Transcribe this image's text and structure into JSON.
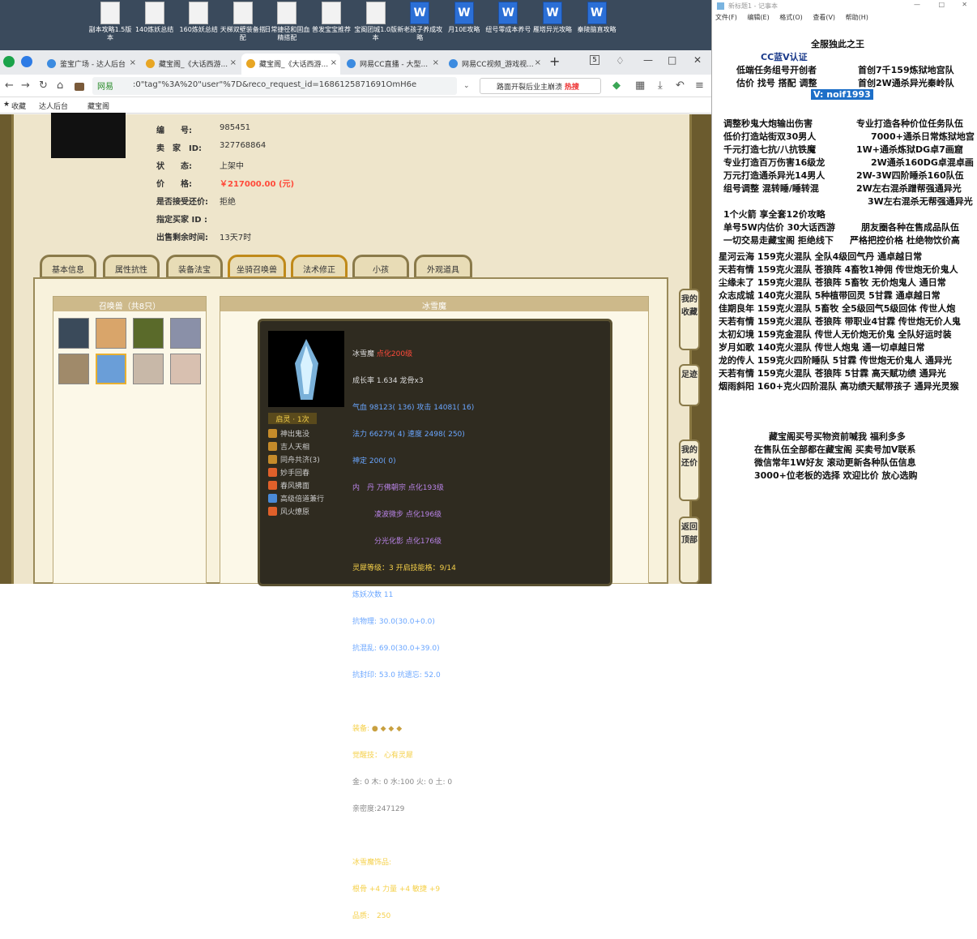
{
  "desktop_icons": [
    {
      "label": "副本攻略1.5版本",
      "type": "file"
    },
    {
      "label": "140炼妖总结",
      "type": "file"
    },
    {
      "label": "160炼妖总结",
      "type": "file"
    },
    {
      "label": "天梯双壁装备搭配",
      "type": "file"
    },
    {
      "label": "日常捷径和固血精搭配",
      "type": "file"
    },
    {
      "label": "普发宝宝推荐",
      "type": "file"
    },
    {
      "label": "宝阁团城1.0版本",
      "type": "file"
    },
    {
      "label": "新老孩子养成攻略",
      "type": "word"
    },
    {
      "label": "月10E攻略",
      "type": "word"
    },
    {
      "label": "纽号零成本养号",
      "type": "word"
    },
    {
      "label": "雁塔异光攻略",
      "type": "word"
    },
    {
      "label": "秦陵脑直攻略",
      "type": "word"
    }
  ],
  "browser": {
    "tabs": [
      {
        "label": "鉴宝广场 - 达人后台"
      },
      {
        "label": "藏宝阁_《大话西游..."
      },
      {
        "label": "藏宝阁_《大话西游..."
      },
      {
        "label": "网易CC直播 - 大型..."
      },
      {
        "label": "网易CC视频_游戏视..."
      }
    ],
    "tab_close": "×",
    "tab_count": "5",
    "window_controls": {
      "minimize": "—",
      "maximize": "□",
      "close": "✕"
    },
    "security_label": "网易",
    "url": ":0\"tag\"%3A%20\"user\"%7D&reco_request_id=1686125871691OmH6e",
    "search_placeholder": "路面开裂后业主崩溃",
    "search_hot": "热搜",
    "bookmarks": [
      {
        "label": "收藏"
      },
      {
        "label": "达人后台"
      },
      {
        "label": "藏宝阁"
      }
    ]
  },
  "listing": {
    "fields": [
      {
        "key": "编　　号:",
        "value": "985451"
      },
      {
        "key": "卖　家　ID:",
        "value": "327768864"
      },
      {
        "key": "状　　态:",
        "value": "上架中"
      },
      {
        "key": "价　　格:",
        "value": "￥217000.00 (元)"
      },
      {
        "key": "是否接受还价:",
        "value": "拒绝"
      },
      {
        "key": "指定买家 ID :",
        "value": ""
      },
      {
        "key": "出售剩余时间:",
        "value": "13天7时"
      }
    ],
    "tabs": [
      {
        "label": "基本信息"
      },
      {
        "label": "属性抗性"
      },
      {
        "label": "装备法宝"
      },
      {
        "label": "坐骑召唤兽"
      },
      {
        "label": "法术修正"
      },
      {
        "label": "小孩"
      },
      {
        "label": "外观道具"
      }
    ],
    "active_tab": 3
  },
  "pets_panel": {
    "title": "召唤兽（共8只）"
  },
  "detail": {
    "title": "冰雪魔",
    "name": "冰雪魔",
    "evolve": "点化200级",
    "growth": "成长率 1.634 龙骨x3",
    "hp": "气血 98123( 136) 攻击 14081( 16)",
    "mp": "法力 66279( 4) 速度 2498( 250)",
    "spirit": "神定 200( 0)",
    "neidan_1": "内　丹 万佛朝宗 点化193级",
    "neidan_2": "　　　凌波微步 点化196级",
    "neidan_3": "　　　分光化影 点化176级",
    "lingxi": "灵犀等级：3 开启技能格：9/14",
    "lianyao": "炼妖次数 11",
    "phys": "抗物理: 30.0(30.0+0.0)",
    "chaos": "抗混乱: 69.0(30.0+39.0)",
    "seal": "抗封印: 53.0 抗遗忘: 52.0",
    "skill_header": "启灵 · 1次",
    "skills": [
      {
        "label": "神出鬼没"
      },
      {
        "label": "吉人天相"
      },
      {
        "label": "同舟共济(3)"
      },
      {
        "label": "妙手回春"
      },
      {
        "label": "春风拂面"
      },
      {
        "label": "高级倍道兼行"
      },
      {
        "label": "风火燎原"
      }
    ],
    "equip_label": "装备:",
    "awaken_label": "觉醒技：",
    "awaken_value": "心有灵犀",
    "elements": "金: 0 木: 0 水:100 火: 0 土: 0",
    "intimacy": "亲密度:247129",
    "accessory_title": "冰雪魔饰品:",
    "accessory_stats": "根骨 +4 力量 +4 敏捷 +9",
    "accessory_quality": "品质:　250"
  },
  "side_buttons": [
    {
      "label": "我的收藏"
    },
    {
      "label": "足迹"
    },
    {
      "label": "我的还价"
    },
    {
      "label": "返回顶部"
    }
  ],
  "notepad": {
    "title": "新标题1 - 记事本",
    "menu": [
      "文件(F)",
      "编辑(E)",
      "格式(O)",
      "查看(V)",
      "帮助(H)"
    ],
    "header_lines": [
      "全服独此之王",
      "CC蓝V认证",
      "低端任务组号开创者",
      "估价 找号 搭配 调整"
    ],
    "right_header": [
      "首创7千159炼狱地宫队",
      "首创2W通杀异光秦岭队"
    ],
    "contact": "V:  noif1993",
    "service_left": [
      "调整秒鬼大炮输出伤害",
      "低价打造站街双30男人",
      "千元打造七抗/八抗铁魔",
      "专业打造百万伤害16级龙",
      "万元打造通杀异光14男人",
      "组号调整 混转睡/睡转混"
    ],
    "service_right": [
      "专业打造各种价位任务队伍",
      "7000+通杀日常炼狱地宫",
      "1W+通杀炼狱DG卓7画窟",
      "2W通杀160DG卓混卓画",
      "2W-3W四阶睡杀160队伍",
      "2W左右混杀蹭帮强通异光",
      "3W左右混杀无帮强通异光"
    ],
    "promo_left": [
      "1个火箭 享全套12价攻略",
      "单号5W内估价 30大话西游",
      "一切交易走藏宝阁 拒绝线下"
    ],
    "promo_right": [
      "朋友圈各种在售成品队伍",
      "严格把控价格 杜绝物饮价高"
    ],
    "teams": [
      "星河云海 159克火混队 全队4级回气丹 通卓越日常",
      "天若有情 159克火混队 苍狼阵 4畜牧1神佣 传世炮无价鬼人",
      "尘缘未了 159克火混队 苍狼阵 5畜牧 无价炮鬼人 通日常",
      "众志成城 140克火混队 5种植带回灵 5甘霖 通卓越日常",
      "佳期良年 159克火混队 5畜牧 全5级回气5级回体 传世人炮",
      "天若有情 159克火混队 苍狼阵 带职业4甘霖 传世炮无价人鬼",
      "太初幻境 159克金混队 传世人无价炮无价鬼 全队好运时装",
      "岁月如歌 140克火混队 传世人炮鬼 通一切卓越日常",
      "龙的传人 159克火四阶睡队 5甘霖 传世炮无价鬼人 通异光",
      "天若有情 159克火混队 苍狼阵 5甘霖 高天赋功绩 通异光",
      "烟雨斜阳 160+克火四阶混队 高功绩天赋带孩子 通异光灵猴"
    ],
    "footer": [
      "藏宝阁买号买物资前喊我 福利多多",
      "在售队伍全部都在藏宝阁 买卖号加V联系",
      "微信常年1W好友 滚动更新各种队伍信息",
      "3000+位老板的选择 欢迎比价 放心选购"
    ]
  }
}
